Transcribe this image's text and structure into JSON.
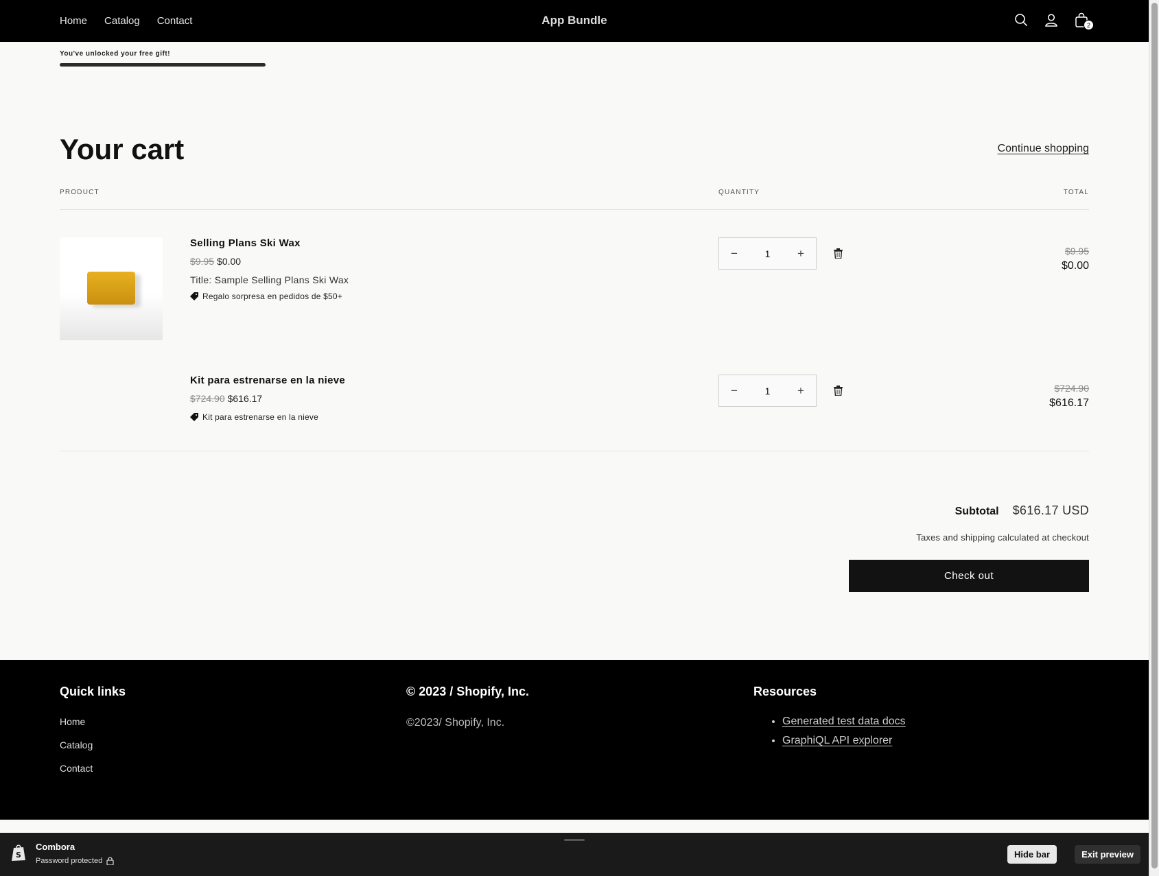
{
  "header": {
    "nav": [
      "Home",
      "Catalog",
      "Contact"
    ],
    "brand": "App Bundle",
    "cart_count": "2",
    "icons": [
      "search-icon",
      "account-icon",
      "cart-icon"
    ]
  },
  "gift_message": "You've unlocked your free gift!",
  "gift_progress": 1.0,
  "cart": {
    "title": "Your cart",
    "continue_label": "Continue shopping",
    "columns": {
      "product": "PRODUCT",
      "quantity": "QUANTITY",
      "total": "TOTAL"
    },
    "items": [
      {
        "name": "Selling Plans Ski Wax",
        "compare_price": "$9.95",
        "price": "$0.00",
        "variant": "Title: Sample Selling Plans Ski Wax",
        "tag": "Regalo sorpresa en pedidos de $50+",
        "quantity": "1",
        "total_old": "$9.95",
        "total_new": "$0.00"
      },
      {
        "name": "Kit para estrenarse en la nieve",
        "compare_price": "$724.90",
        "price": "$616.17",
        "tag": "Kit para estrenarse en la nieve",
        "quantity": "1",
        "total_old": "$724.90",
        "total_new": "$616.17"
      }
    ],
    "subtotal_label": "Subtotal",
    "subtotal_value": "$616.17 USD",
    "taxes_note": "Taxes and shipping calculated at checkout",
    "checkout_label": "Check out"
  },
  "footer": {
    "quick_links_title": "Quick links",
    "quick_links": [
      "Home",
      "Catalog",
      "Contact"
    ],
    "copyright_title": "© 2023 / Shopify, Inc.",
    "copyright_text": "©2023/ Shopify, Inc.",
    "resources_title": "Resources",
    "resources": [
      "Generated test data docs",
      "GraphiQL API explorer"
    ]
  },
  "preview_bar": {
    "store_name": "Combora",
    "status": "Password protected",
    "hide_label": "Hide bar",
    "exit_label": "Exit preview"
  }
}
